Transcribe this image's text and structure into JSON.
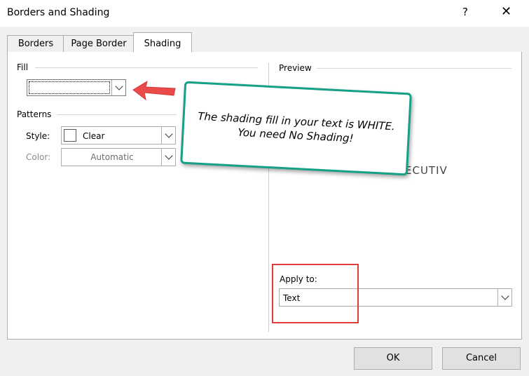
{
  "dialog": {
    "title": "Borders and Shading",
    "help_label": "?",
    "close_label": "✕"
  },
  "tabs": [
    {
      "label": "Borders",
      "active": false
    },
    {
      "label": "Page Border",
      "active": false
    },
    {
      "label": "Shading",
      "active": true
    }
  ],
  "fill": {
    "label": "Fill",
    "value": ""
  },
  "patterns": {
    "label": "Patterns",
    "style_label": "Style:",
    "style_value": "Clear",
    "color_label": "Color:",
    "color_value": "Automatic"
  },
  "preview": {
    "label": "Preview",
    "sample_text": "ECUTIV"
  },
  "apply_to": {
    "label": "Apply to:",
    "value": "Text"
  },
  "buttons": {
    "ok": "OK",
    "cancel": "Cancel"
  },
  "annotation": {
    "text_line1": "The shading fill in your text is WHITE.",
    "text_line2": "You need No Shading!",
    "arrow_color": "#e94b4b",
    "border_color": "#16a085"
  },
  "colors": {
    "highlight_box": "#e03c3c"
  },
  "icons": [
    "help-icon",
    "close-icon",
    "chevron-down-icon",
    "arrow-icon"
  ]
}
